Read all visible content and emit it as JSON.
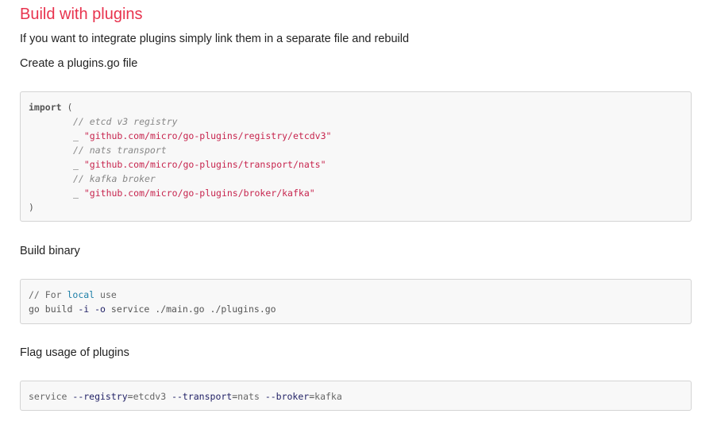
{
  "section": {
    "title": "Build with plugins",
    "intro": "If you want to integrate plugins simply link them in a separate file and rebuild",
    "create_file": "Create a plugins.go file",
    "build_binary": "Build binary",
    "flag_usage": "Flag usage of plugins"
  },
  "code_import": {
    "keyword": "import",
    "open": "(",
    "close": ")",
    "blank": "_",
    "comment_registry": "// etcd v3 registry",
    "path_registry": "\"github.com/micro/go-plugins/registry/etcdv3\"",
    "comment_transport": "// nats transport",
    "path_transport": "\"github.com/micro/go-plugins/transport/nats\"",
    "comment_broker": "// kafka broker",
    "path_broker": "\"github.com/micro/go-plugins/broker/kafka\""
  },
  "code_build": {
    "comment_prefix": "// For ",
    "comment_keyword": "local",
    "comment_suffix": " use",
    "cmd_go": "go build ",
    "flag_i": "-i",
    "flag_o": "-o",
    "cmd_rest": " service ./main.go ./plugins.go"
  },
  "code_flag": {
    "cmd": "service ",
    "flag_registry": "--registry",
    "val_registry": "etcdv3",
    "flag_transport": "--transport",
    "val_transport": "nats",
    "flag_broker": "--broker",
    "val_broker": "kafka",
    "equals": "="
  },
  "colors": {
    "title": "#e8334e",
    "string": "#c7254e",
    "keyword_blue": "#1d7fa8",
    "code_background": "#f8f8f8"
  }
}
